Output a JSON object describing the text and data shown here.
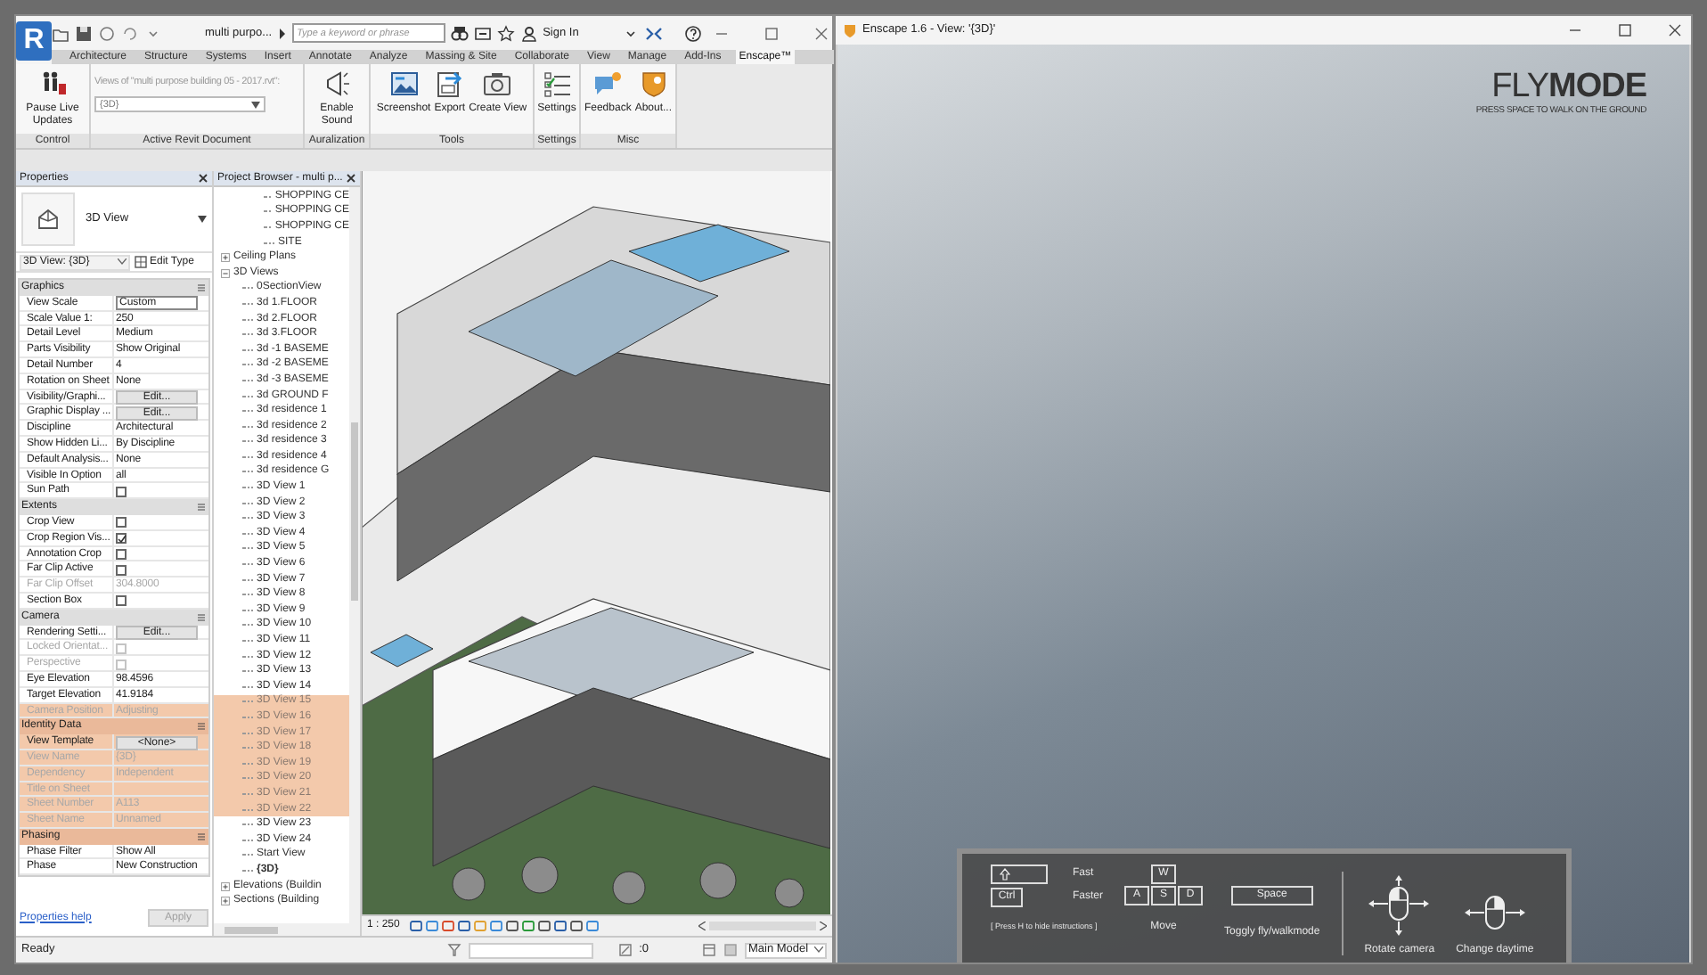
{
  "revit": {
    "logo": "R",
    "title": "multi purpo...",
    "search": {
      "placeholder": "Type a keyword or phrase"
    },
    "sign_in": "Sign In",
    "tabs": [
      {
        "label": "Architecture",
        "selected": false
      },
      {
        "label": "Structure",
        "selected": false
      },
      {
        "label": "Systems",
        "selected": false
      },
      {
        "label": "Insert",
        "selected": false
      },
      {
        "label": "Annotate",
        "selected": false
      },
      {
        "label": "Analyze",
        "selected": false
      },
      {
        "label": "Massing & Site",
        "selected": false
      },
      {
        "label": "Collaborate",
        "selected": false
      },
      {
        "label": "View",
        "selected": false
      },
      {
        "label": "Manage",
        "selected": false
      },
      {
        "label": "Add-Ins",
        "selected": false
      },
      {
        "label": "Enscape™",
        "selected": true
      }
    ],
    "ribbon_panels": [
      {
        "kind": "tools",
        "title": "Control",
        "tools": [
          {
            "label": "Pause Live Updates"
          }
        ]
      },
      {
        "kind": "document",
        "title": "Active Revit Document",
        "caption": "Views of \"multi purpose building 05 - 2017.rvt\":",
        "value": "{3D}"
      },
      {
        "kind": "tools",
        "title": "Auralization",
        "tools": [
          {
            "label": "Enable Sound"
          }
        ]
      },
      {
        "kind": "tools",
        "title": "Tools",
        "tools": [
          {
            "label": "Screenshot"
          },
          {
            "label": "Export"
          },
          {
            "label": "Create View"
          }
        ]
      },
      {
        "kind": "tools",
        "title": "Settings",
        "tools": [
          {
            "label": "Settings"
          }
        ]
      },
      {
        "kind": "tools",
        "title": "Misc",
        "tools": [
          {
            "label": "Feedback"
          },
          {
            "label": "About..."
          }
        ]
      }
    ],
    "properties": {
      "title": "Properties",
      "type_name": "3D View",
      "selector": "3D View: {3D}",
      "edit_type": "Edit Type",
      "sections": [
        {
          "title": "Graphics",
          "highlighted": false,
          "rows": [
            {
              "kind": "field",
              "label": "View Scale",
              "value": "Custom",
              "disabled": false,
              "highlighted": false
            },
            {
              "kind": "text",
              "label": "Scale Value    1:",
              "value": "250",
              "disabled": false,
              "highlighted": false
            },
            {
              "kind": "text",
              "label": "Detail Level",
              "value": "Medium",
              "disabled": false,
              "highlighted": false
            },
            {
              "kind": "text",
              "label": "Parts Visibility",
              "value": "Show Original",
              "disabled": false,
              "highlighted": false
            },
            {
              "kind": "text",
              "label": "Detail Number",
              "value": "4",
              "disabled": false,
              "highlighted": false
            },
            {
              "kind": "text",
              "label": "Rotation on Sheet",
              "value": "None",
              "disabled": false,
              "highlighted": false
            },
            {
              "kind": "button",
              "label": "Visibility/Graphi...",
              "value": "Edit...",
              "disabled": false,
              "highlighted": false
            },
            {
              "kind": "button",
              "label": "Graphic Display ...",
              "value": "Edit...",
              "disabled": false,
              "highlighted": false
            },
            {
              "kind": "text",
              "label": "Discipline",
              "value": "Architectural",
              "disabled": false,
              "highlighted": false
            },
            {
              "kind": "text",
              "label": "Show Hidden Li...",
              "value": "By Discipline",
              "disabled": false,
              "highlighted": false
            },
            {
              "kind": "text",
              "label": "Default Analysis...",
              "value": "None",
              "disabled": false,
              "highlighted": false
            },
            {
              "kind": "text",
              "label": "Visible In Option",
              "value": "all",
              "disabled": false,
              "highlighted": false
            },
            {
              "kind": "checkbox",
              "label": "Sun Path",
              "checked": false,
              "disabled": false,
              "highlighted": false
            }
          ]
        },
        {
          "title": "Extents",
          "highlighted": false,
          "rows": [
            {
              "kind": "checkbox",
              "label": "Crop View",
              "checked": false,
              "disabled": false,
              "highlighted": false
            },
            {
              "kind": "checkbox",
              "label": "Crop Region Vis...",
              "checked": true,
              "disabled": false,
              "highlighted": false
            },
            {
              "kind": "checkbox",
              "label": "Annotation Crop",
              "checked": false,
              "disabled": false,
              "highlighted": false
            },
            {
              "kind": "checkbox",
              "label": "Far Clip Active",
              "checked": false,
              "disabled": false,
              "highlighted": false
            },
            {
              "kind": "text",
              "label": "Far Clip Offset",
              "value": "304.8000",
              "disabled": true,
              "highlighted": false
            },
            {
              "kind": "checkbox",
              "label": "Section Box",
              "checked": false,
              "disabled": false,
              "highlighted": false
            }
          ]
        },
        {
          "title": "Camera",
          "highlighted": false,
          "rows": [
            {
              "kind": "button",
              "label": "Rendering Setti...",
              "value": "Edit...",
              "disabled": false,
              "highlighted": false
            },
            {
              "kind": "checkbox",
              "label": "Locked Orientat...",
              "checked": false,
              "disabled": true,
              "highlighted": false
            },
            {
              "kind": "checkbox",
              "label": "Perspective",
              "checked": false,
              "disabled": true,
              "highlighted": false
            },
            {
              "kind": "text",
              "label": "Eye Elevation",
              "value": "98.4596",
              "disabled": false,
              "highlighted": false
            },
            {
              "kind": "text",
              "label": "Target Elevation",
              "value": "41.9184",
              "disabled": false,
              "highlighted": false
            },
            {
              "kind": "text",
              "label": "Camera Position",
              "value": "Adjusting",
              "disabled": true,
              "highlighted": true
            }
          ]
        },
        {
          "title": "Identity Data",
          "highlighted": true,
          "rows": [
            {
              "kind": "button",
              "label": "View Template",
              "value": "<None>",
              "disabled": false,
              "highlighted": true
            },
            {
              "kind": "text",
              "label": "View Name",
              "value": "{3D}",
              "disabled": true,
              "highlighted": true
            },
            {
              "kind": "text",
              "label": "Dependency",
              "value": "Independent",
              "disabled": true,
              "highlighted": true
            },
            {
              "kind": "text",
              "label": "Title on Sheet",
              "disabled": true,
              "highlighted": true
            },
            {
              "kind": "text",
              "label": "Sheet Number",
              "value": "A113",
              "disabled": true,
              "highlighted": true
            },
            {
              "kind": "text",
              "label": "Sheet Name",
              "value": "Unnamed",
              "disabled": true,
              "highlighted": true
            }
          ]
        },
        {
          "title": "Phasing",
          "highlighted": true,
          "rows": [
            {
              "kind": "text",
              "label": "Phase Filter",
              "value": "Show All",
              "disabled": false,
              "highlighted": false
            },
            {
              "kind": "text",
              "label": "Phase",
              "value": "New Construction",
              "disabled": false,
              "highlighted": false
            }
          ]
        }
      ],
      "help_link": "Properties help",
      "apply": "Apply"
    },
    "project_browser": {
      "title": "Project Browser - multi p...",
      "tree": [
        {
          "children": [
            {
              "label": "SHOPPING CE",
              "selected": false,
              "highlighted": false
            },
            {
              "label": "SHOPPING CE",
              "selected": false,
              "highlighted": false
            },
            {
              "label": "SHOPPING CE",
              "selected": false,
              "highlighted": false
            },
            {
              "label": "SITE",
              "selected": false,
              "highlighted": false
            }
          ]
        },
        {
          "label": "Ceiling Plans",
          "expanded": false,
          "selected": false,
          "highlighted": false
        },
        {
          "label": "3D Views",
          "expanded": true,
          "selected": false,
          "highlighted": false,
          "children": [
            {
              "label": "0SectionView",
              "selected": false,
              "highlighted": false
            },
            {
              "label": "3d 1.FLOOR",
              "selected": false,
              "highlighted": false
            },
            {
              "label": "3d 2.FLOOR",
              "selected": false,
              "highlighted": false
            },
            {
              "label": "3d 3.FLOOR",
              "selected": false,
              "highlighted": false
            },
            {
              "label": "3d -1 BASEME",
              "selected": false,
              "highlighted": false
            },
            {
              "label": "3d -2 BASEME",
              "selected": false,
              "highlighted": false
            },
            {
              "label": "3d -3 BASEME",
              "selected": false,
              "highlighted": false
            },
            {
              "label": "3d GROUND F",
              "selected": false,
              "highlighted": false
            },
            {
              "label": "3d residence 1",
              "selected": false,
              "highlighted": false
            },
            {
              "label": "3d residence 2",
              "selected": false,
              "highlighted": false
            },
            {
              "label": "3d residence 3",
              "selected": false,
              "highlighted": false
            },
            {
              "label": "3d residence 4",
              "selected": false,
              "highlighted": false
            },
            {
              "label": "3d residence G",
              "selected": false,
              "highlighted": false
            },
            {
              "label": "3D View 1",
              "selected": false,
              "highlighted": false
            },
            {
              "label": "3D View 2",
              "selected": false,
              "highlighted": false
            },
            {
              "label": "3D View 3",
              "selected": false,
              "highlighted": false
            },
            {
              "label": "3D View 4",
              "selected": false,
              "highlighted": false
            },
            {
              "label": "3D View 5",
              "selected": false,
              "highlighted": false
            },
            {
              "label": "3D View 6",
              "selected": false,
              "highlighted": false
            },
            {
              "label": "3D View 7",
              "selected": false,
              "highlighted": false
            },
            {
              "label": "3D View 8",
              "selected": false,
              "highlighted": false
            },
            {
              "label": "3D View 9",
              "selected": false,
              "highlighted": false
            },
            {
              "label": "3D View 10",
              "selected": false,
              "highlighted": false
            },
            {
              "label": "3D View 11",
              "selected": false,
              "highlighted": false
            },
            {
              "label": "3D View 12",
              "selected": false,
              "highlighted": false
            },
            {
              "label": "3D View 13",
              "selected": false,
              "highlighted": false
            },
            {
              "label": "3D View 14",
              "selected": false,
              "highlighted": false
            },
            {
              "label": "3D View 15",
              "selected": false,
              "highlighted": true
            },
            {
              "label": "3D View 16",
              "selected": false,
              "highlighted": true
            },
            {
              "label": "3D View 17",
              "selected": false,
              "highlighted": true
            },
            {
              "label": "3D View 18",
              "selected": false,
              "highlighted": true
            },
            {
              "label": "3D View 19",
              "selected": false,
              "highlighted": true
            },
            {
              "label": "3D View 20",
              "selected": false,
              "highlighted": true
            },
            {
              "label": "3D View 21",
              "selected": false,
              "highlighted": true
            },
            {
              "label": "3D View 22",
              "selected": false,
              "highlighted": true
            },
            {
              "label": "3D View 23",
              "selected": false,
              "highlighted": false
            },
            {
              "label": "3D View 24",
              "selected": false,
              "highlighted": false
            },
            {
              "label": "Start View",
              "selected": false,
              "highlighted": false
            },
            {
              "label": "{3D}",
              "selected": true,
              "highlighted": false
            }
          ]
        },
        {
          "label": "Elevations (Buildin",
          "expanded": false,
          "selected": false,
          "highlighted": false
        },
        {
          "label": "Sections (Building",
          "expanded": false,
          "selected": false,
          "highlighted": false
        }
      ]
    },
    "view": {
      "scale": "1 : 250"
    },
    "status_bar": {
      "text": "Ready",
      "selection_count": ":0",
      "model": "Main Model"
    }
  },
  "enscape": {
    "title": "Enscape 1.6 - View: '{3D}'",
    "heading": "FLY**MODE**",
    "hint": "PRESS SPACE TO WALK ON THE GROUND",
    "instructions": {
      "speed": [
        {
          "kind": "arrow",
          "label": "Fast"
        },
        {
          "kind": "text",
          "key": "Ctrl",
          "label": "Faster"
        }
      ],
      "hide_hint": "[ Press H to hide instructions ]",
      "move": {
        "keys": [
          "W",
          "A",
          "S",
          "D"
        ],
        "label": "Move"
      },
      "toggle": {
        "key": "Space",
        "label": "Toggly fly/walkmode"
      },
      "mouse": [
        {
          "kind": "rotate",
          "label": "Rotate camera"
        },
        {
          "kind": "daytime",
          "label": "Change daytime"
        }
      ]
    }
  }
}
